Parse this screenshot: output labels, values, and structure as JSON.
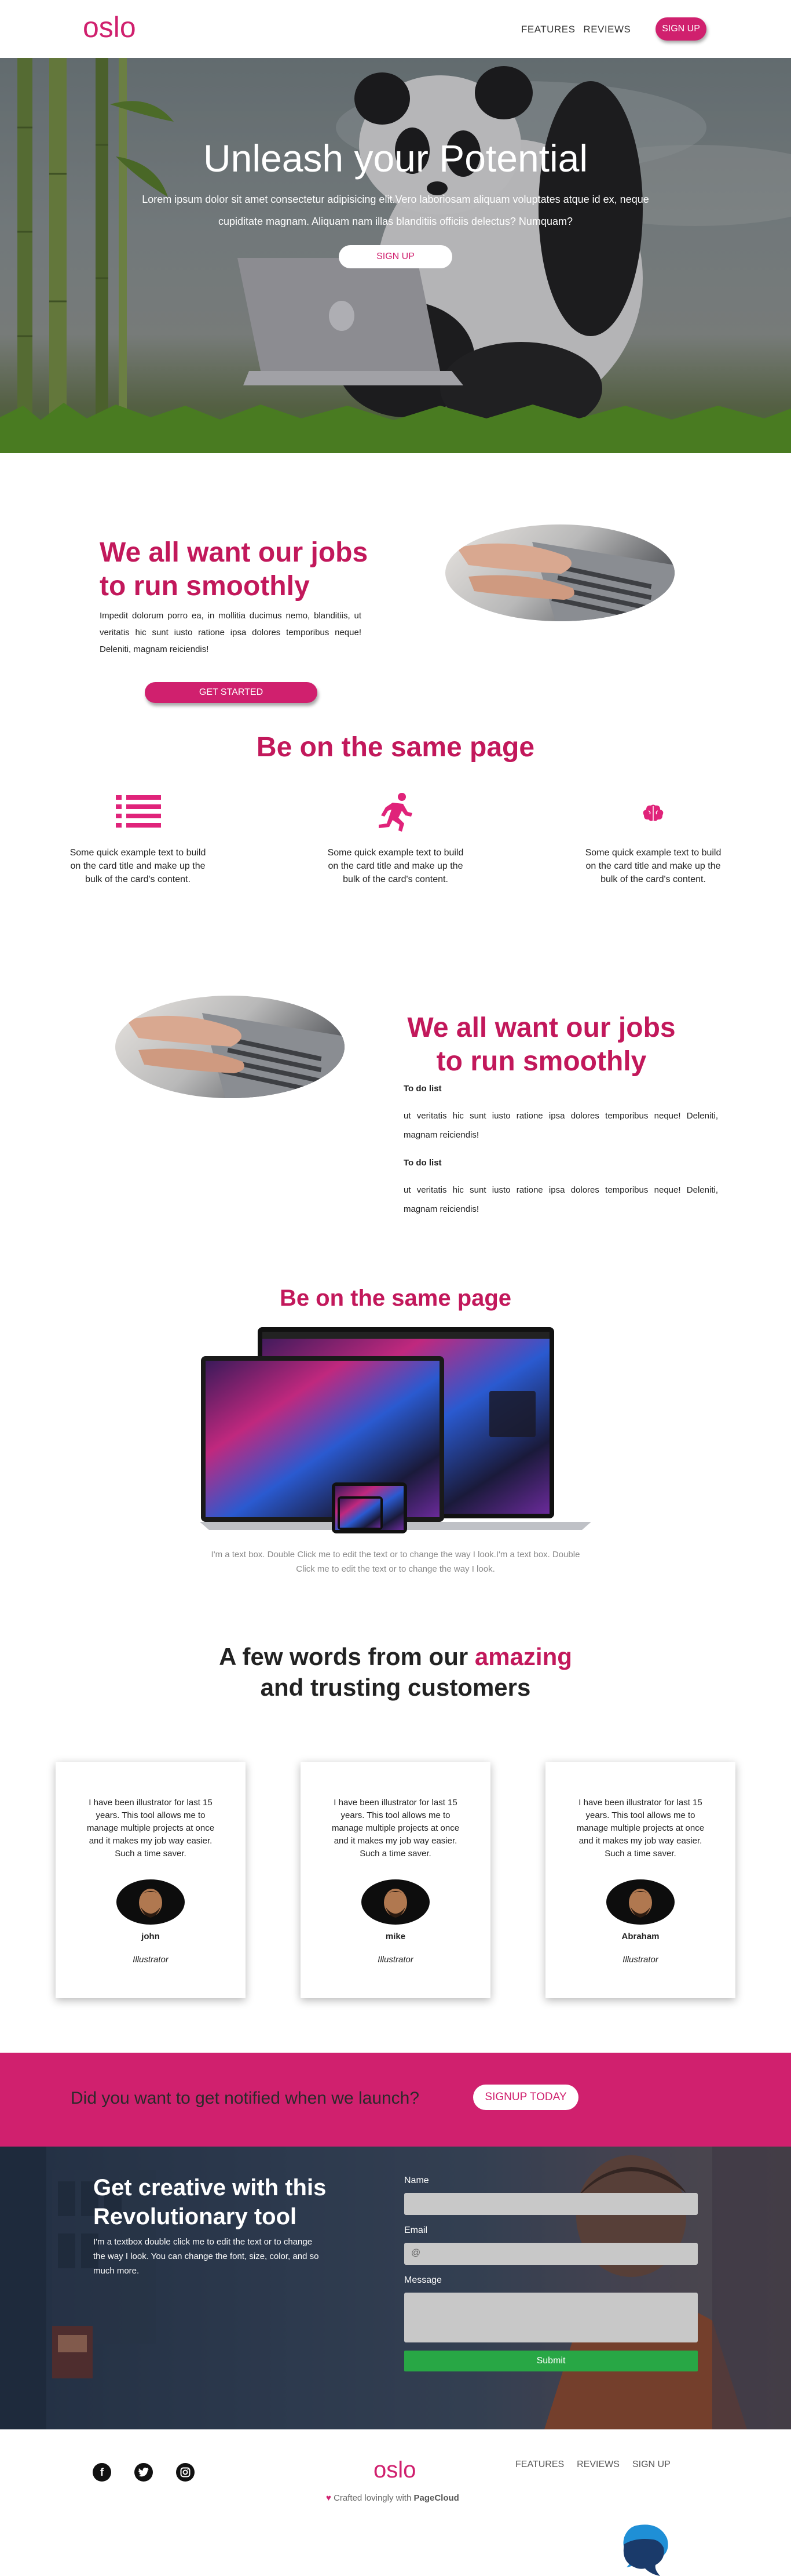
{
  "nav": {
    "logo": "oslo",
    "links": [
      "FEATURES",
      "REVIEWS"
    ],
    "signup": "SIGN UP"
  },
  "hero": {
    "title": "Unleash your Potential",
    "text": "Lorem ipsum dolor sit amet consectetur adipisicing elit.Vero laboriosam aliquam voluptates atque id ex, neque cupiditate magnam. Aliquam nam illas blanditiis officiis delectus? Numquam?",
    "button": "SIGN UP"
  },
  "section1": {
    "title": "We all want our jobs to run smoothly",
    "text": "Impedit dolorum porro ea, in mollitia ducimus nemo, blanditiis, ut veritatis hic sunt iusto ratione ipsa dolores temporibus neque! Deleniti, magnam reiciendis!",
    "button": "GET STARTED"
  },
  "features": {
    "title": "Be on the same page",
    "items": [
      {
        "icon": "list-icon",
        "text": "Some quick example text to build on the card title and make up the bulk of the card's content."
      },
      {
        "icon": "running-person-icon",
        "text": "Some quick example text to build on the card title and make up the bulk of the card's content."
      },
      {
        "icon": "brain-icon",
        "text": "Some quick example text to build on the card title and make up the bulk of the card's content."
      }
    ]
  },
  "section3": {
    "title": "We all want our jobs to run smoothly",
    "lists": [
      {
        "heading": "To do list",
        "body": "ut veritatis hic sunt iusto ratione ipsa dolores temporibus neque! Deleniti, magnam reiciendis!"
      },
      {
        "heading": "To do list",
        "body": "ut veritatis hic sunt iusto ratione ipsa dolores temporibus neque! Deleniti, magnam reiciendis!"
      }
    ]
  },
  "devices": {
    "title": "Be on the same page",
    "caption": "I'm a text box. Double Click me to edit the text or to change the way I look.I'm a text box. Double Click me to edit the text or to change the way I look."
  },
  "testimonials": {
    "title_before": "A few words from our ",
    "title_highlight": "amazing",
    "title_after": " and trusting customers",
    "cards": [
      {
        "quote": "I have been illustrator for last 15 years. This tool allows me to manage multiple projects at once and it makes my job way easier. Such a time saver.",
        "name": "john",
        "role": "Illustrator"
      },
      {
        "quote": "I have been illustrator for last 15 years. This tool allows me to manage multiple projects at once and it makes my job way easier. Such a time saver.",
        "name": "mike",
        "role": "Illustrator"
      },
      {
        "quote": "I have been illustrator for last 15 years. This tool allows me to manage multiple projects at once and it makes my job way easier. Such a time saver.",
        "name": "Abraham",
        "role": "Illustrator"
      }
    ]
  },
  "notify": {
    "text": "Did you want to get notified when we launch?",
    "button": "SIGNUP TODAY"
  },
  "creative": {
    "title": "Get creative with this Revolutionary tool",
    "text": "I'm a textbox double click me to edit the text or to change the way I look. You can change the font, size, color, and so much more.",
    "form": {
      "name_label": "Name",
      "email_label": "Email",
      "email_placeholder": "@",
      "message_label": "Message",
      "submit": "Submit"
    }
  },
  "footer": {
    "logo": "oslo",
    "credit_prefix": "Crafted lovingly with ",
    "credit_brand": "PageCloud",
    "links": [
      "FEATURES",
      "REVIEWS",
      "SIGN UP"
    ],
    "social": [
      "facebook-icon",
      "twitter-icon",
      "instagram-icon"
    ]
  },
  "colors": {
    "brand": "#d0206e",
    "heading": "#c2185b",
    "submit": "#28a745"
  }
}
